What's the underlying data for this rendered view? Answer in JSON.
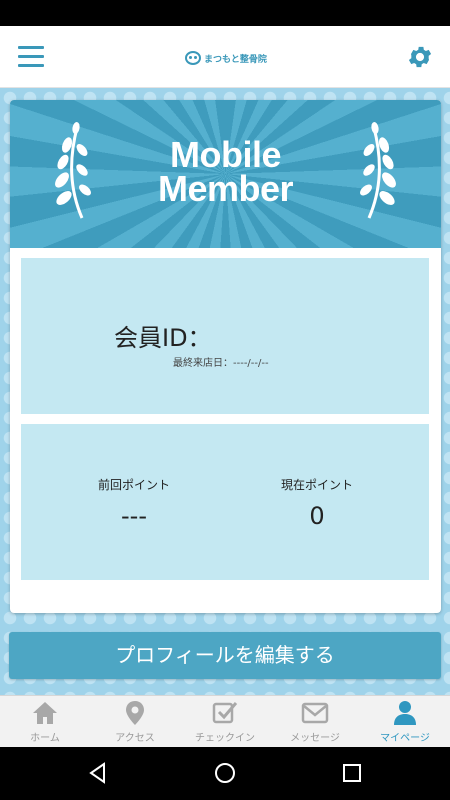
{
  "header": {
    "logo_text": "まつもと整骨院",
    "menu_icon": "hamburger-menu-icon",
    "settings_icon": "gear-icon"
  },
  "banner": {
    "title_line1": "Mobile",
    "title_line2": "Member"
  },
  "member": {
    "id_label": "会員ID：",
    "last_visit": "最終来店日：----/--/--"
  },
  "points": {
    "previous_label": "前回ポイント",
    "previous_value": "---",
    "current_label": "現在ポイント",
    "current_value": "0"
  },
  "edit_button_label": "プロフィールを編集する",
  "tabs": [
    {
      "label": "ホーム",
      "icon": "home-icon",
      "active": false
    },
    {
      "label": "アクセス",
      "icon": "map-pin-icon",
      "active": false
    },
    {
      "label": "チェックイン",
      "icon": "checkin-icon",
      "active": false
    },
    {
      "label": "メッセージ",
      "icon": "mail-icon",
      "active": false
    },
    {
      "label": "マイページ",
      "icon": "user-icon",
      "active": true
    }
  ],
  "colors": {
    "accent": "#3a98b9",
    "button": "#4da6c4",
    "panel": "#c4e8f2",
    "background": "#9fd3ea",
    "tab_active": "#2f97c0",
    "tab_inactive": "#999999"
  }
}
